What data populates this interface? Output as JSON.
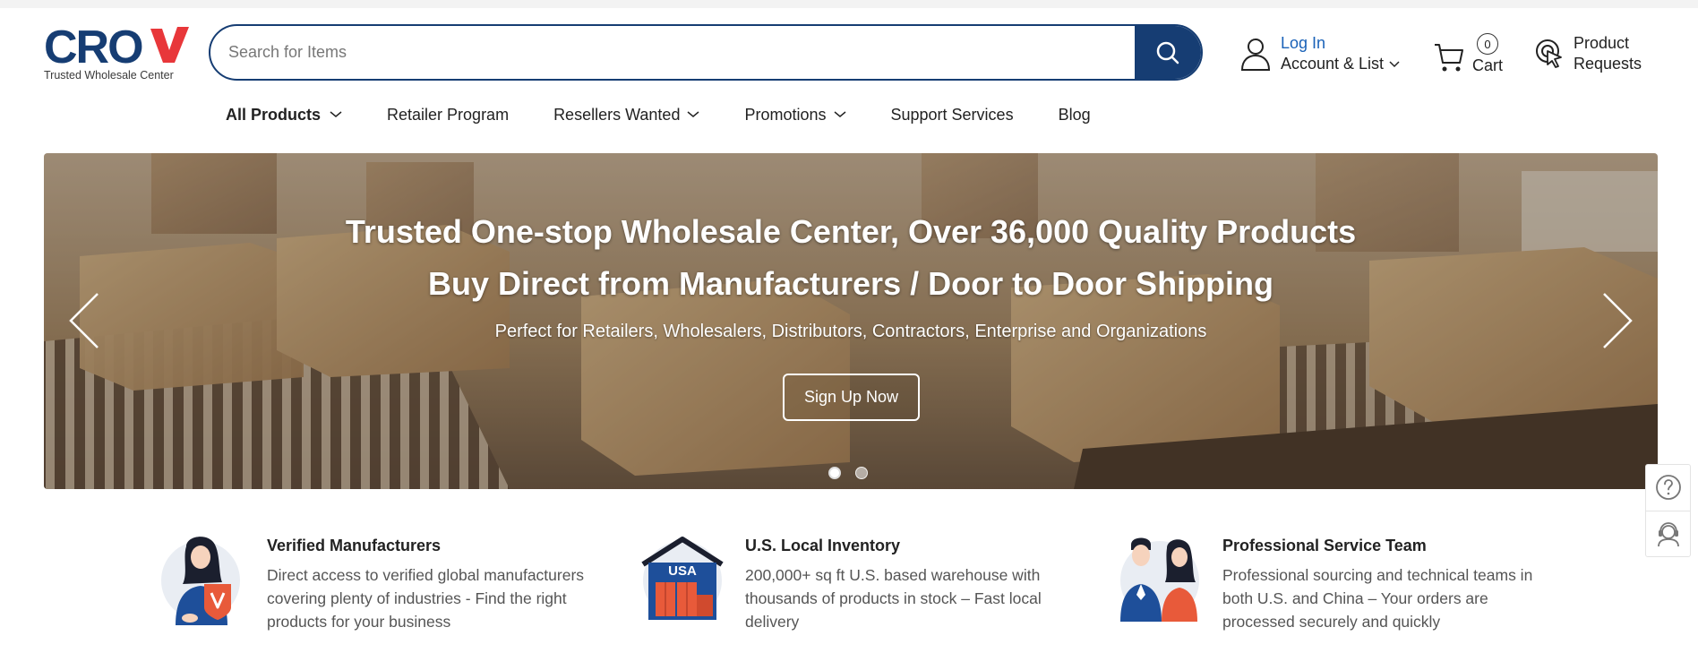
{
  "brand": {
    "logo_text": "CROV",
    "tagline": "Trusted Wholesale Center",
    "navy": "#163d73",
    "accent_red": "#e8373a",
    "link_blue": "#1a62b8"
  },
  "header": {
    "search_placeholder": "Search for Items",
    "search_icon": "search-icon",
    "login_label": "Log In",
    "account_label": "Account & List",
    "cart_count": "0",
    "cart_label": "Cart",
    "product_requests_line1": "Product",
    "product_requests_line2": "Requests"
  },
  "nav": {
    "items": [
      {
        "label": "All Products",
        "has_dropdown": true
      },
      {
        "label": "Retailer Program",
        "has_dropdown": false
      },
      {
        "label": "Resellers Wanted",
        "has_dropdown": true
      },
      {
        "label": "Promotions",
        "has_dropdown": true
      },
      {
        "label": "Support Services",
        "has_dropdown": false
      },
      {
        "label": "Blog",
        "has_dropdown": false
      }
    ]
  },
  "hero": {
    "headline_1": "Trusted One-stop Wholesale Center, Over 36,000 Quality Products",
    "headline_2": "Buy Direct from Manufacturers / Door to Door Shipping",
    "subtitle": "Perfect for Retailers, Wholesalers, Distributors, Contractors, Enterprise and Organizations",
    "cta_label": "Sign Up Now",
    "slide_count": 2,
    "active_slide": 1
  },
  "features": [
    {
      "title": "Verified Manufacturers",
      "description": "Direct access to verified global manufacturers covering plenty of industries - Find the right products for your business",
      "icon": "verified-manufacturer-illustration"
    },
    {
      "title": "U.S. Local Inventory",
      "description": "200,000+ sq ft U.S. based warehouse with thousands of products in stock – Fast local delivery",
      "icon": "usa-warehouse-illustration",
      "badge_text": "USA"
    },
    {
      "title": "Professional Service Team",
      "description": "Professional sourcing and technical teams in both U.S. and China – Your orders are processed securely and quickly",
      "icon": "service-team-illustration"
    }
  ],
  "side_tools": [
    "help-icon",
    "customer-service-icon"
  ]
}
